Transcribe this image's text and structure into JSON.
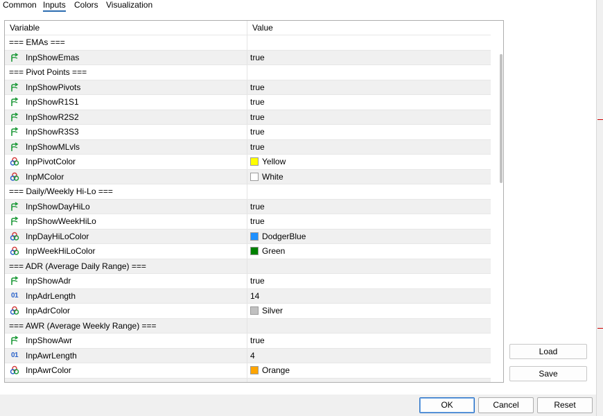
{
  "tabs": [
    {
      "label": "Common",
      "active": false
    },
    {
      "label": "Inputs",
      "active": true
    },
    {
      "label": "Colors",
      "active": false
    },
    {
      "label": "Visualization",
      "active": false
    }
  ],
  "grid": {
    "columns": {
      "variable": "Variable",
      "value": "Value"
    },
    "rows": [
      {
        "kind": "section",
        "variable": "=== EMAs ===",
        "value": ""
      },
      {
        "kind": "bool",
        "variable": "InpShowEmas",
        "value": "true"
      },
      {
        "kind": "section",
        "variable": "=== Pivot Points ===",
        "value": ""
      },
      {
        "kind": "bool",
        "variable": "InpShowPivots",
        "value": "true"
      },
      {
        "kind": "bool",
        "variable": "InpShowR1S1",
        "value": "true"
      },
      {
        "kind": "bool",
        "variable": "InpShowR2S2",
        "value": "true"
      },
      {
        "kind": "bool",
        "variable": "InpShowR3S3",
        "value": "true"
      },
      {
        "kind": "bool",
        "variable": "InpShowMLvls",
        "value": "true"
      },
      {
        "kind": "color",
        "variable": "InpPivotColor",
        "value": "Yellow",
        "swatch": "#ffff00"
      },
      {
        "kind": "color",
        "variable": "InpMColor",
        "value": "White",
        "swatch": "#ffffff"
      },
      {
        "kind": "section",
        "variable": "=== Daily/Weekly Hi-Lo ===",
        "value": ""
      },
      {
        "kind": "bool",
        "variable": "InpShowDayHiLo",
        "value": "true"
      },
      {
        "kind": "bool",
        "variable": "InpShowWeekHiLo",
        "value": "true"
      },
      {
        "kind": "color",
        "variable": "InpDayHiLoColor",
        "value": "DodgerBlue",
        "swatch": "#1e90ff"
      },
      {
        "kind": "color",
        "variable": "InpWeekHiLoColor",
        "value": "Green",
        "swatch": "#008000"
      },
      {
        "kind": "section",
        "variable": "=== ADR (Average Daily Range) ===",
        "value": ""
      },
      {
        "kind": "bool",
        "variable": "InpShowAdr",
        "value": "true"
      },
      {
        "kind": "int",
        "variable": "InpAdrLength",
        "value": "14"
      },
      {
        "kind": "color",
        "variable": "InpAdrColor",
        "value": "Silver",
        "swatch": "#c0c0c0"
      },
      {
        "kind": "section",
        "variable": "=== AWR (Average Weekly Range) ===",
        "value": ""
      },
      {
        "kind": "bool",
        "variable": "InpShowAwr",
        "value": "true"
      },
      {
        "kind": "int",
        "variable": "InpAwrLength",
        "value": "4"
      },
      {
        "kind": "color",
        "variable": "InpAwrColor",
        "value": "Orange",
        "swatch": "#ffa500"
      }
    ]
  },
  "icons": {
    "bool": "arrow-branch-icon",
    "color": "color-circles-icon",
    "int": "integer-icon",
    "int_glyph": "01"
  },
  "side_buttons": {
    "load": "Load",
    "save": "Save"
  },
  "footer": {
    "ok": "OK",
    "cancel": "Cancel",
    "reset": "Reset"
  }
}
